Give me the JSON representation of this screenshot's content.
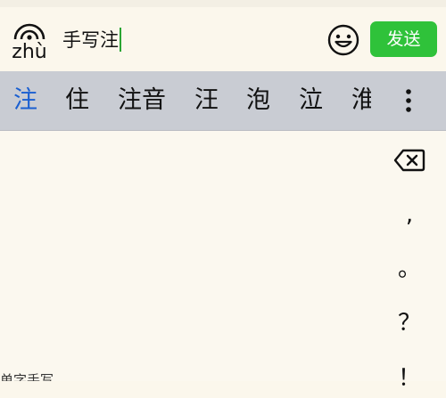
{
  "input_bar": {
    "pinyin": "zhù",
    "text": "手写注",
    "send_label": "发送"
  },
  "candidates": [
    {
      "label": "注",
      "selected": true
    },
    {
      "label": "住",
      "selected": false
    },
    {
      "label": "注音",
      "selected": false
    },
    {
      "label": "汪",
      "selected": false
    },
    {
      "label": "泡",
      "selected": false
    },
    {
      "label": "泣",
      "selected": false
    },
    {
      "label": "淮",
      "selected": false
    }
  ],
  "keyboard": {
    "punctuation": [
      ",",
      "。",
      "？",
      "！"
    ],
    "mode_label": "单字手写"
  },
  "icons": {
    "pinyin_badge": "wifi-arc-icon",
    "emoji": "smiley-icon",
    "more": "vertical-dots-icon",
    "delete": "backspace-icon"
  },
  "colors": {
    "send_button": "#2fc23a",
    "selected_candidate": "#1a5fd1",
    "candidate_bar": "#c9ccd3",
    "caret": "#2aa532"
  }
}
